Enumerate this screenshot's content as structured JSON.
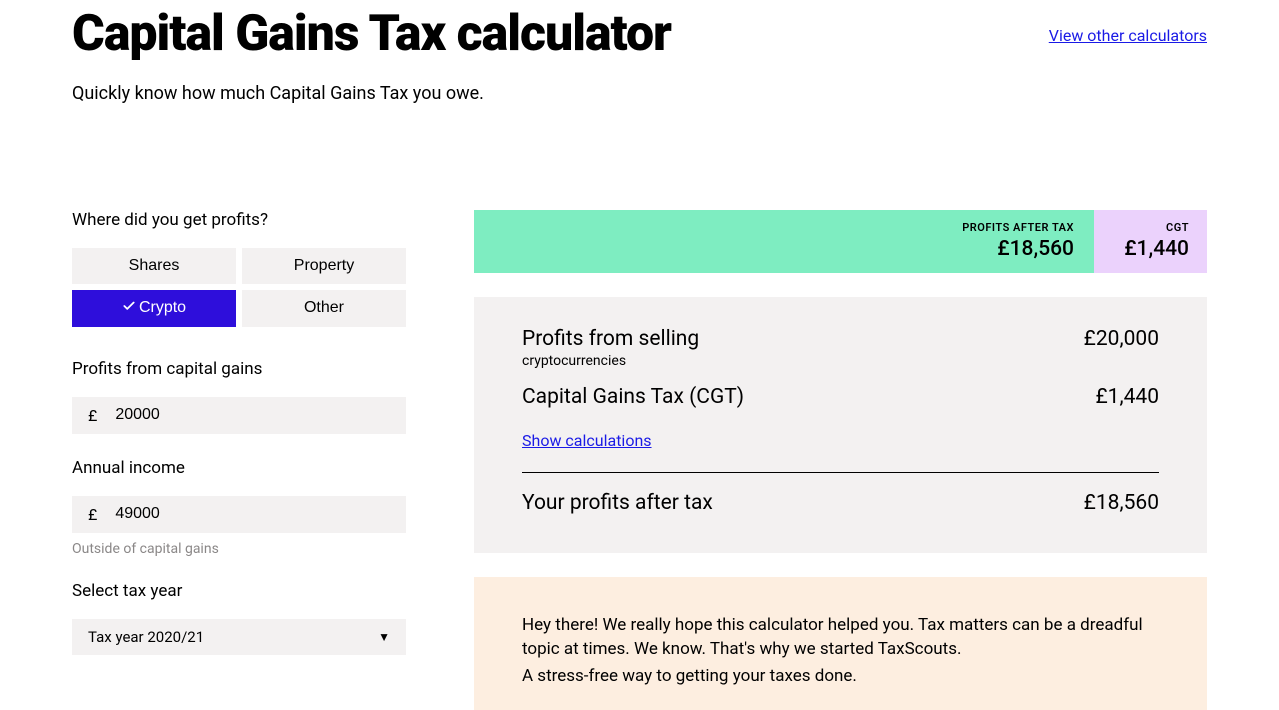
{
  "header": {
    "title": "Capital Gains Tax calculator",
    "other_link": "View other calculators",
    "subtitle": "Quickly know how much Capital Gains Tax you owe."
  },
  "form": {
    "profits_source_label": "Where did you get profits?",
    "options": {
      "shares": "Shares",
      "property": "Property",
      "crypto": "Crypto",
      "other": "Other"
    },
    "profits_label": "Profits from capital gains",
    "currency_symbol": "£",
    "profits_value": "20000",
    "income_label": "Annual income",
    "income_value": "49000",
    "income_hint": "Outside of capital gains",
    "tax_year_label": "Select tax year",
    "tax_year_value": "Tax year 2020/21"
  },
  "summary": {
    "profits_after_tax_label": "PROFITS AFTER TAX",
    "profits_after_tax_value": "£18,560",
    "cgt_label": "CGT",
    "cgt_value": "£1,440"
  },
  "breakdown": {
    "row1_title": "Profits from selling",
    "row1_sub": "cryptocurrencies",
    "row1_value": "£20,000",
    "row2_title": "Capital Gains Tax (CGT)",
    "row2_value": "£1,440",
    "show_calc": "Show calculations",
    "final_title": "Your profits after tax",
    "final_value": "£18,560"
  },
  "promo": {
    "line1": "Hey there! We really hope this calculator helped you. Tax matters can be a dreadful topic at times. We know. That's why we started TaxScouts.",
    "line2": "A stress-free way to getting your taxes done."
  }
}
